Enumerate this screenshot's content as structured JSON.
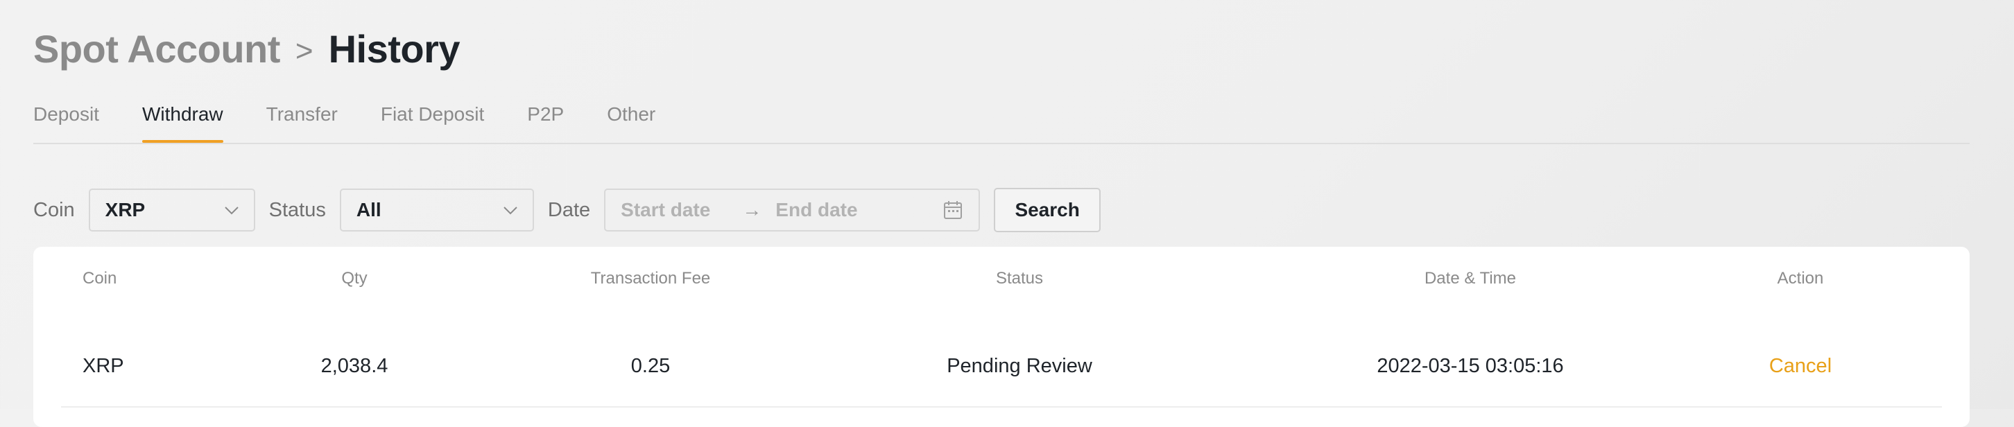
{
  "header": {
    "breadcrumb_parent": "Spot Account",
    "breadcrumb_separator": ">",
    "page_title": "History"
  },
  "tabs": [
    {
      "label": "Deposit",
      "active": false
    },
    {
      "label": "Withdraw",
      "active": true
    },
    {
      "label": "Transfer",
      "active": false
    },
    {
      "label": "Fiat Deposit",
      "active": false
    },
    {
      "label": "P2P",
      "active": false
    },
    {
      "label": "Other",
      "active": false
    }
  ],
  "filters": {
    "coin_label": "Coin",
    "coin_value": "XRP",
    "status_label": "Status",
    "status_value": "All",
    "date_label": "Date",
    "start_placeholder": "Start date",
    "end_placeholder": "End date",
    "range_arrow": "→",
    "search_label": "Search"
  },
  "table": {
    "columns": [
      "Coin",
      "Qty",
      "Transaction Fee",
      "Status",
      "Date & Time",
      "Action"
    ],
    "rows": [
      {
        "coin": "XRP",
        "qty": "2,038.4",
        "fee": "0.25",
        "status": "Pending Review",
        "datetime": "2022-03-15 03:05:16",
        "action": "Cancel"
      }
    ]
  },
  "colors": {
    "accent": "#f0a024",
    "action_link": "#e8a018",
    "muted_text": "#8a8a8a",
    "primary_text": "#1e2329"
  },
  "icons": {
    "dropdown": "chevron-down-icon",
    "calendar": "calendar-icon"
  }
}
